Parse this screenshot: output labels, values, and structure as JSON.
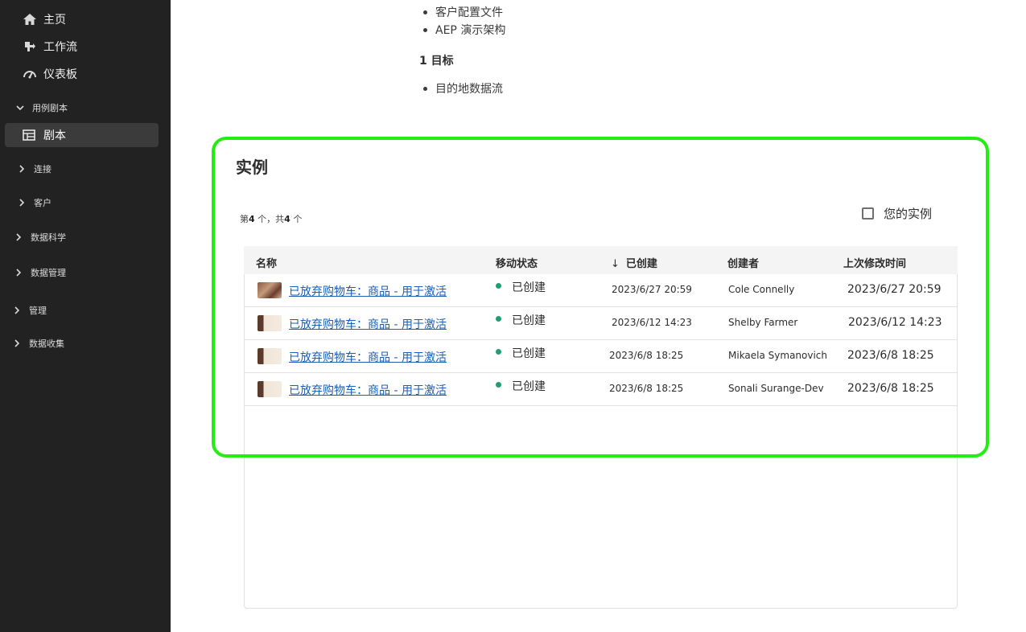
{
  "sidebar": {
    "top_items": [
      {
        "label": "主页",
        "icon": "home-icon"
      },
      {
        "label": "工作流",
        "icon": "workflow-icon"
      },
      {
        "label": "仪表板",
        "icon": "dashboard-icon"
      }
    ],
    "sections": [
      {
        "label": "用例剧本",
        "expanded": true
      },
      {
        "label": "连接",
        "expanded": false
      },
      {
        "label": "客户",
        "expanded": false
      },
      {
        "label": "数据科学",
        "expanded": false
      },
      {
        "label": "数据管理",
        "expanded": false
      },
      {
        "label": "管理",
        "expanded": false
      },
      {
        "label": "数据收集",
        "expanded": false
      }
    ],
    "active_item": {
      "label": "剧本",
      "icon": "playbook-icon"
    }
  },
  "content": {
    "bullets_top": [
      "客户配置文件",
      "AEP 演示架构"
    ],
    "subheading": "1 目标",
    "bullets_bottom": [
      "目的地数据流"
    ]
  },
  "instances": {
    "title": "实例",
    "count_prefix": "第",
    "count_shown": "4",
    "count_mid": "个，共",
    "count_total": "4",
    "count_suffix": "个",
    "your_instances_label": "您的实例",
    "your_instances_checked": false,
    "columns": {
      "name": "名称",
      "status": "移动状态",
      "created": "已创建",
      "creator": "创建者",
      "modified": "上次修改时间"
    },
    "sort_icon": "arrow-down-icon",
    "rows": [
      {
        "name": "已放弃购物车：商品 - 用于激活",
        "status": "已创建",
        "created": "2023/6/27 20:59",
        "creator": "Cole Connelly",
        "modified": "2023/6/27 20:59"
      },
      {
        "name": "已放弃购物车：商品 - 用于激活",
        "status": "已创建",
        "created": "2023/6/12 14:23",
        "creator": "Shelby Farmer",
        "modified": "2023/6/12 14:23"
      },
      {
        "name": "已放弃购物车：商品 - 用于激活",
        "status": "已创建",
        "created": "2023/6/8 18:25",
        "creator": "Mikaela Symanovich",
        "modified": "2023/6/8 18:25"
      },
      {
        "name": "已放弃购物车：商品 - 用于激活",
        "status": "已创建",
        "created": "2023/6/8 18:25",
        "creator": "Sonali Surange-Dev",
        "modified": "2023/6/8 18:25"
      }
    ]
  },
  "colors": {
    "sidebar_bg": "#222222",
    "highlight": "#22ee11",
    "link": "#1a5fb4",
    "status_green": "#1f9d74"
  }
}
